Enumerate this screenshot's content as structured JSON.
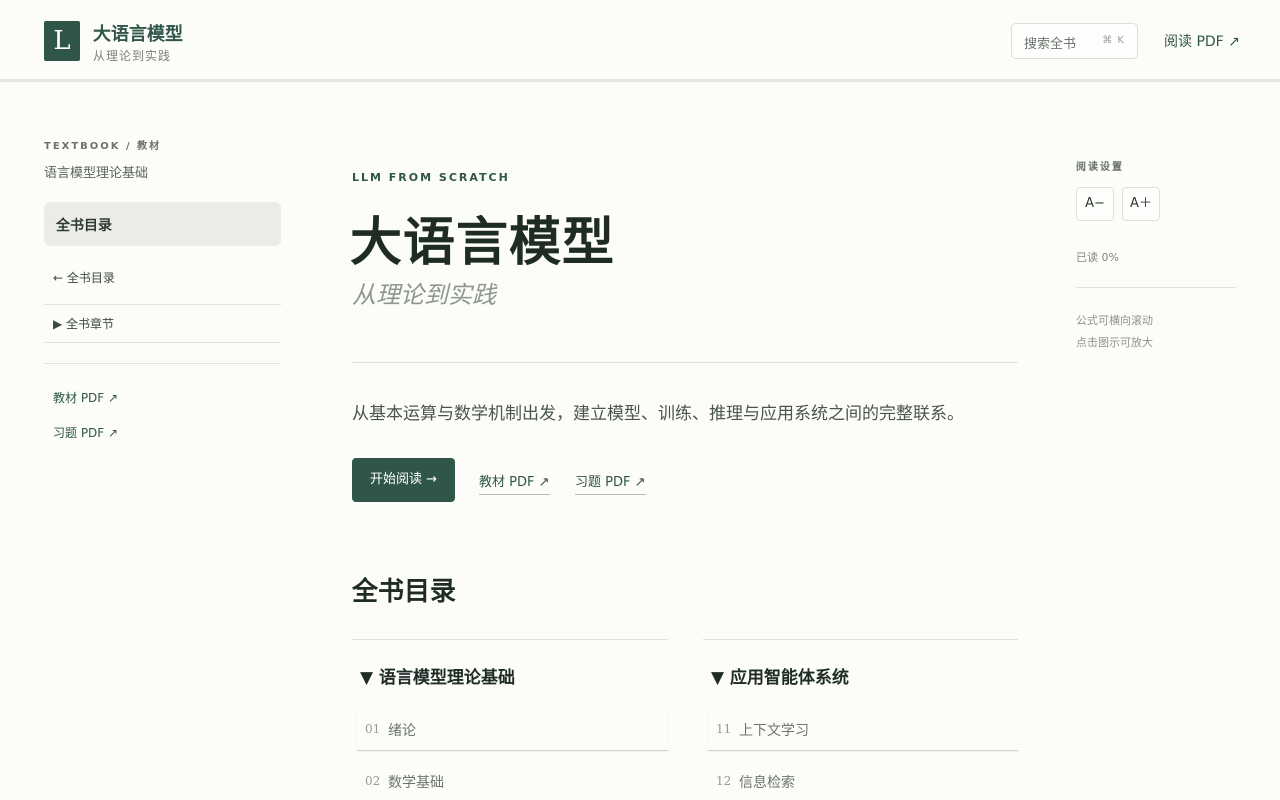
{
  "header": {
    "logo_letter": "L",
    "title": "大语言模型",
    "subtitle": "从理论到实践",
    "search_placeholder": "搜索全书",
    "search_shortcut": "⌘ K",
    "read_pdf_label": "阅读 PDF ↗"
  },
  "sidebar": {
    "eyebrow": "TEXTBOOK / 教材",
    "book_name": "语言模型理论基础",
    "active_item": "全书目录",
    "back_link": "← 全书目录",
    "chapters_toggle": "▶ 全书章节",
    "links": [
      "教材 PDF ↗",
      "习题 PDF ↗"
    ]
  },
  "hero": {
    "eyebrow": "LLM FROM SCRATCH",
    "title": "大语言模型",
    "subtitle": "从理论到实践",
    "description": "从基本运算与数学机制出发，建立模型、训练、推理与应用系统之间的完整联系。",
    "start_button": "开始阅读 →",
    "textbook_pdf": "教材 PDF ↗",
    "exercise_pdf": "习题 PDF ↗"
  },
  "toc": {
    "heading": "全书目录",
    "parts": [
      {
        "title": "▼ 语言模型理论基础",
        "chapters": [
          {
            "num": "01",
            "title": "绪论"
          },
          {
            "num": "02",
            "title": "数学基础"
          }
        ]
      },
      {
        "title": "▼ 应用智能体系统",
        "chapters": [
          {
            "num": "11",
            "title": "上下文学习"
          },
          {
            "num": "12",
            "title": "信息检索"
          }
        ]
      }
    ]
  },
  "reading_panel": {
    "title": "阅读设置",
    "font_decrease": "A−",
    "font_increase": "A＋",
    "progress": "已读 0%",
    "notes": [
      "公式可横向滚动",
      "点击图示可放大"
    ]
  },
  "colors": {
    "accent": "#2f5648",
    "background": "#fcfcf9",
    "text": "#1f2b25"
  }
}
